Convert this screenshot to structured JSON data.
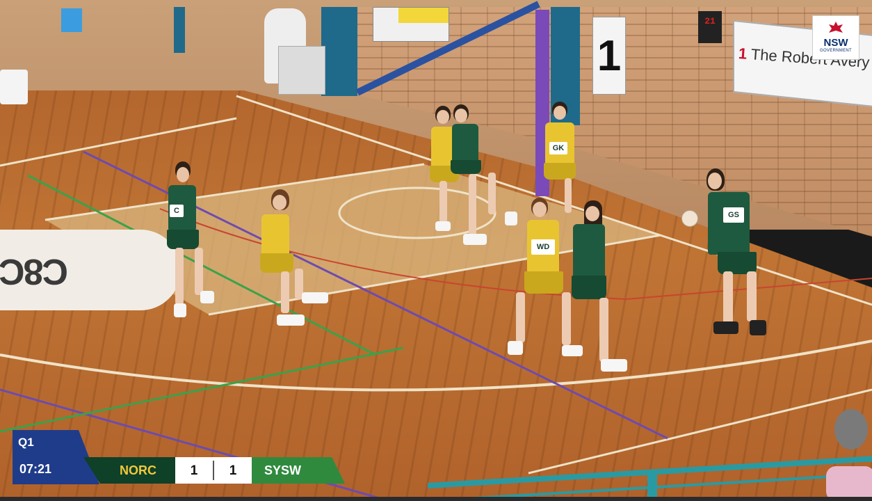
{
  "scoreboard": {
    "quarter": "Q1",
    "clock": "07:21",
    "home_team": "NORC",
    "home_score": "1",
    "away_team": "SYSW",
    "away_score": "1"
  },
  "venue": {
    "banner_number": "1",
    "banner_text": "The Robert Avery Cou",
    "goal_post_sign": "1",
    "shot_clock": "21",
    "court_logo": "C8C"
  },
  "sponsor": {
    "name": "NSW",
    "tagline": "GOVERNMENT"
  },
  "players": [
    {
      "position": "GK"
    },
    {
      "position": "C"
    },
    {
      "position": "WD"
    },
    {
      "position": "GS"
    },
    {
      "position": "C"
    }
  ],
  "colors": {
    "home_team": "#e8c530",
    "away_team": "#1e5a3f",
    "scorebug_blue": "#1f3c8a",
    "scorebug_green": "#2f8a3e",
    "nsw_red": "#c8102e"
  }
}
